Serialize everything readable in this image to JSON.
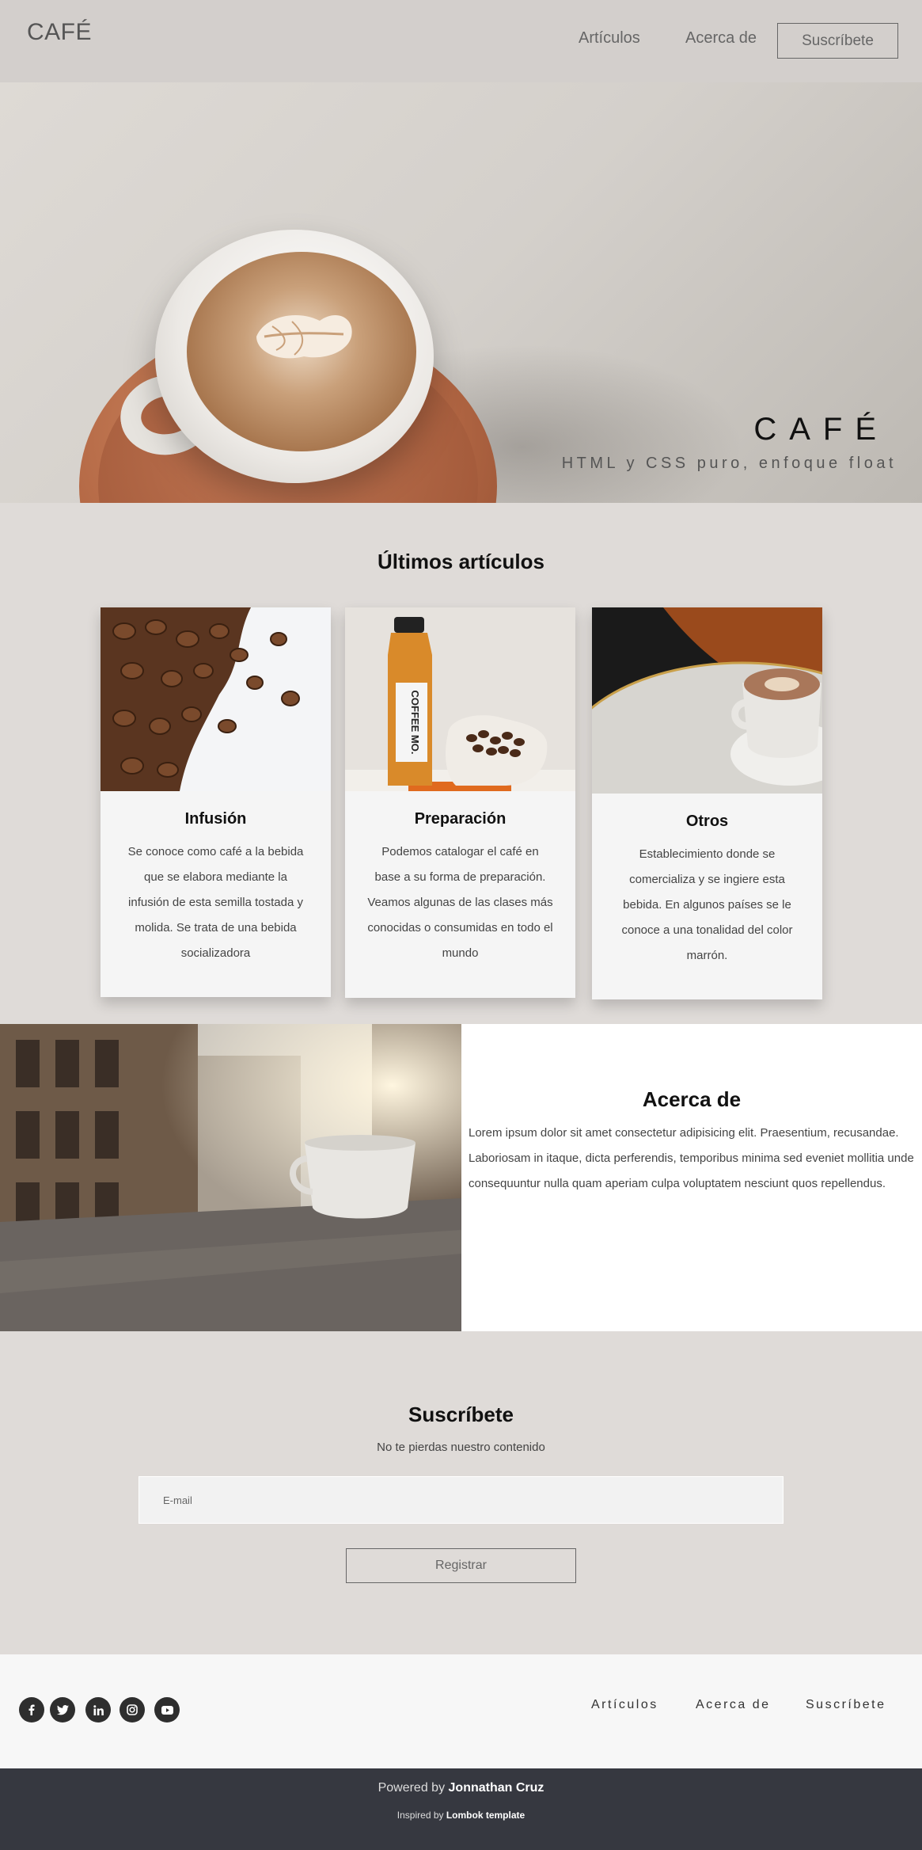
{
  "header": {
    "logo": "CAFÉ",
    "nav": {
      "articles": "Artículos",
      "about": "Acerca de",
      "subscribe": "Suscríbete"
    }
  },
  "hero": {
    "title": "CAFÉ",
    "subtitle": "HTML y CSS puro, enfoque float"
  },
  "articles": {
    "title": "Últimos artículos",
    "cards": [
      {
        "title": "Infusión",
        "text": "Se conoce como café a la bebida que se elabora mediante la infusión de esta semilla tostada y molida. Se trata de una bebida socializadora"
      },
      {
        "title": "Preparación",
        "text": "Podemos catalogar el café en base a su forma de preparación. Veamos algunas de las clases más conocidas o consumidas en todo el mundo",
        "bottle_label": "COFFEE MO."
      },
      {
        "title": "Otros",
        "text": "Establecimiento donde se comercializa y se ingiere esta bebida. En algunos países se le conoce a una tonalidad del color marrón."
      }
    ]
  },
  "about": {
    "title": "Acerca de",
    "text": "Lorem ipsum dolor sit amet consectetur adipisicing elit. Praesentium, recusandae. Laboriosam in itaque, dicta perferendis, temporibus minima sed eveniet mollitia unde consequuntur nulla quam aperiam culpa voluptatem nesciunt quos repellendus."
  },
  "subscribe": {
    "title": "Suscríbete",
    "text": "No te pierdas nuestro contenido",
    "email_placeholder": "E-mail",
    "button": "Registrar"
  },
  "footer": {
    "social_icons": [
      "facebook-icon",
      "twitter-icon",
      "linkedin-icon",
      "instagram-icon",
      "youtube-icon"
    ],
    "links": {
      "articles": "Artículos",
      "about": "Acerca de",
      "subscribe": "Suscríbete"
    },
    "powered_prefix": "Powered by",
    "powered_name": "Jonnathan Cruz",
    "inspired_prefix": "Inspired by",
    "inspired_name": "Lombok template"
  }
}
